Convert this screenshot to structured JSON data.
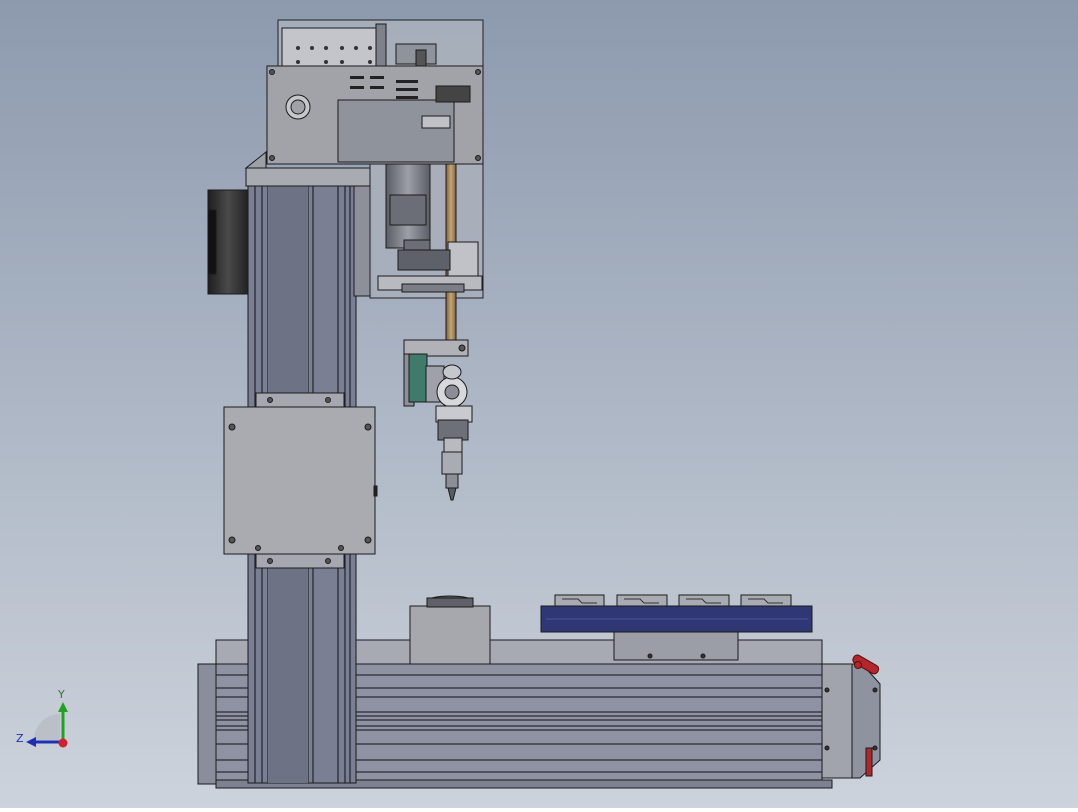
{
  "view": {
    "background_top": "#8d9aae",
    "background_bottom": "#cdd3dc"
  },
  "colors": {
    "frame_dark": "#5f6472",
    "rail": "#7a7f93",
    "sheet_metal": "#9c9ea5",
    "sheet_metal_light": "#b0b2b8",
    "enclosure_glass": "#a9b0bc",
    "motor_black": "#2c2c2c",
    "fixture_blue": "#2f3775",
    "brass": "#a88a5a",
    "green_part": "#3f7a6a",
    "red_handle": "#b3262c",
    "outline": "#1b1b1b"
  },
  "triad": {
    "y_label": "Y",
    "z_label": "Z",
    "y_color": "#1fa31f",
    "z_color": "#1f2fb3",
    "x_color": "#d0202a"
  }
}
